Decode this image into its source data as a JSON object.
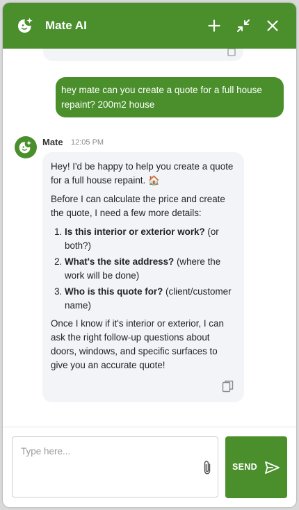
{
  "header": {
    "title": "Mate AI",
    "icons": [
      "sparkle-face-logo",
      "plus-icon",
      "collapse-icon",
      "close-icon"
    ]
  },
  "messages": {
    "user": {
      "text": "hey mate can you create a quote for a full house repaint? 200m2 house"
    },
    "bot": {
      "sender": "Mate",
      "time": "12:05 PM",
      "intro": "Hey! I'd be happy to help you create a quote for a full house repaint. 🏠",
      "lead": "Before I can calculate the price and create the quote, I need a few more details:",
      "questions": [
        {
          "bold": "Is this interior or exterior work?",
          "rest": " (or both?)"
        },
        {
          "bold": "What's the site address?",
          "rest": " (where the work will be done)"
        },
        {
          "bold": "Who is this quote for?",
          "rest": " (client/customer name)"
        }
      ],
      "outro": "Once I know if it's interior or exterior, I can ask the right follow-up questions about doors, windows, and specific surfaces to give you an accurate quote!"
    }
  },
  "composer": {
    "placeholder": "Type here...",
    "value": "",
    "send_label": "SEND"
  },
  "colors": {
    "brand": "#4a8f2c",
    "bubble_bg": "#f3f4f8"
  }
}
